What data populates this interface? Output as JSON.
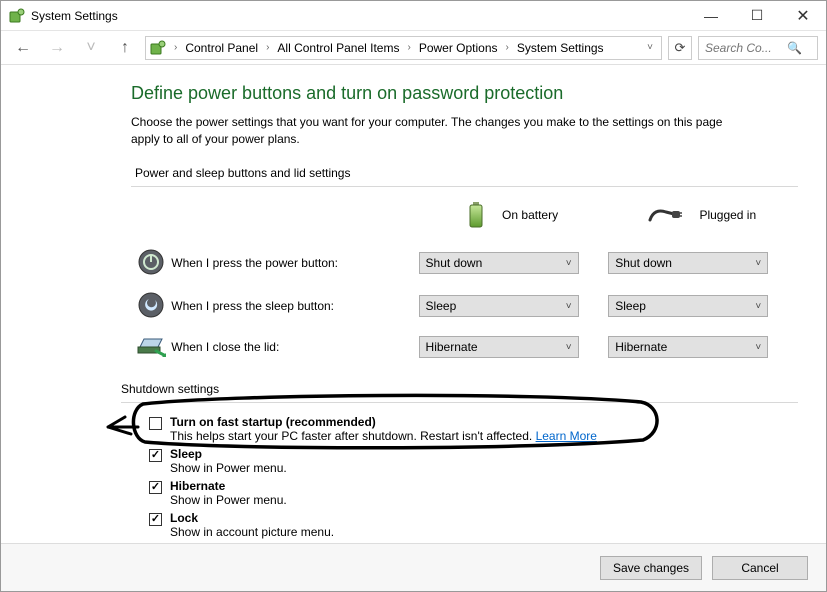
{
  "window": {
    "title": "System Settings",
    "minimize_glyph": "—",
    "maximize_glyph": "☐",
    "close_glyph": "✕"
  },
  "nav": {
    "back_glyph": "←",
    "forward_glyph": "→",
    "up_glyph": "˅",
    "up_arrow": "↑",
    "refresh_glyph": "⟳",
    "dropdown_glyph": "˅"
  },
  "breadcrumbs": {
    "c0": "Control Panel",
    "c1": "All Control Panel Items",
    "c2": "Power Options",
    "c3": "System Settings",
    "sep": "›"
  },
  "search": {
    "placeholder": "Search Co...",
    "icon_glyph": "🔍"
  },
  "page": {
    "title": "Define power buttons and turn on password protection",
    "desc": "Choose the power settings that you want for your computer. The changes you make to the settings on this page apply to all of your power plans."
  },
  "sections": {
    "power_sleep": "Power and sleep buttons and lid settings",
    "shutdown": "Shutdown settings"
  },
  "columns": {
    "battery": "On battery",
    "plugged": "Plugged in"
  },
  "rows": {
    "power_btn": {
      "label": "When I press the power button:",
      "battery": "Shut down",
      "plugged": "Shut down"
    },
    "sleep_btn": {
      "label": "When I press the sleep button:",
      "battery": "Sleep",
      "plugged": "Sleep"
    },
    "lid": {
      "label": "When I close the lid:",
      "battery": "Hibernate",
      "plugged": "Hibernate"
    }
  },
  "shutdown": {
    "fast_startup": {
      "title": "Turn on fast startup (recommended)",
      "desc": "This helps start your PC faster after shutdown. Restart isn't affected. ",
      "learn": "Learn More",
      "checked": false
    },
    "sleep": {
      "title": "Sleep",
      "desc": "Show in Power menu.",
      "checked": true
    },
    "hibernate": {
      "title": "Hibernate",
      "desc": "Show in Power menu.",
      "checked": true
    },
    "lock": {
      "title": "Lock",
      "desc": "Show in account picture menu.",
      "checked": true
    }
  },
  "footer": {
    "save": "Save changes",
    "cancel": "Cancel"
  },
  "combo_chev": "˅"
}
